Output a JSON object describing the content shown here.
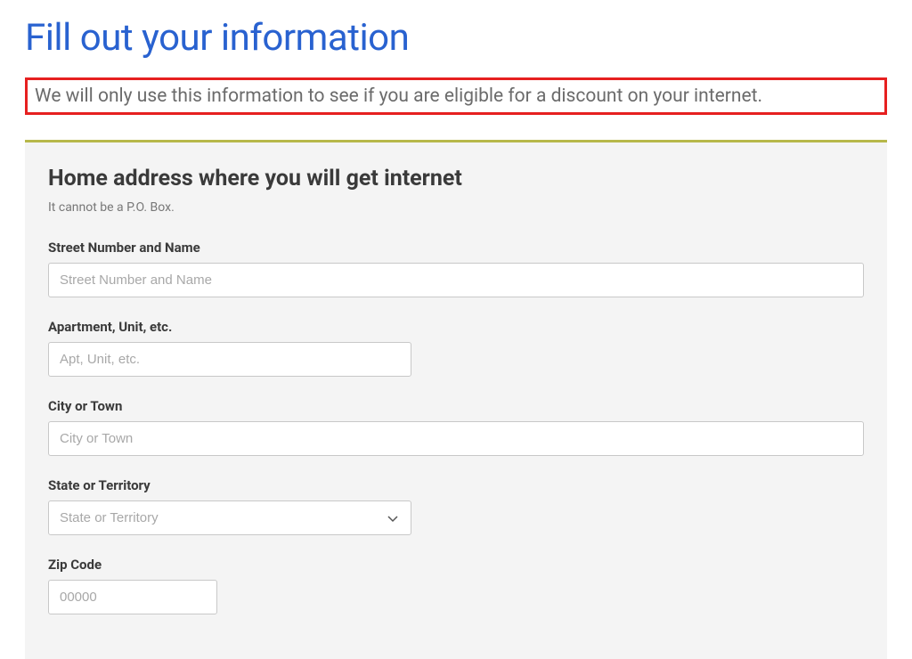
{
  "page": {
    "title": "Fill out your information",
    "note": "We will only use this information to see if you are eligible for a discount on your internet."
  },
  "section": {
    "title": "Home address where you will get internet",
    "subtitle": "It cannot be a P.O. Box."
  },
  "fields": {
    "street": {
      "label": "Street Number and Name",
      "placeholder": "Street Number and Name"
    },
    "apartment": {
      "label": "Apartment, Unit, etc.",
      "placeholder": "Apt, Unit, etc."
    },
    "city": {
      "label": "City or Town",
      "placeholder": "City or Town"
    },
    "state": {
      "label": "State or Territory",
      "placeholder": "State or Territory"
    },
    "zip": {
      "label": "Zip Code",
      "placeholder": "00000"
    }
  }
}
